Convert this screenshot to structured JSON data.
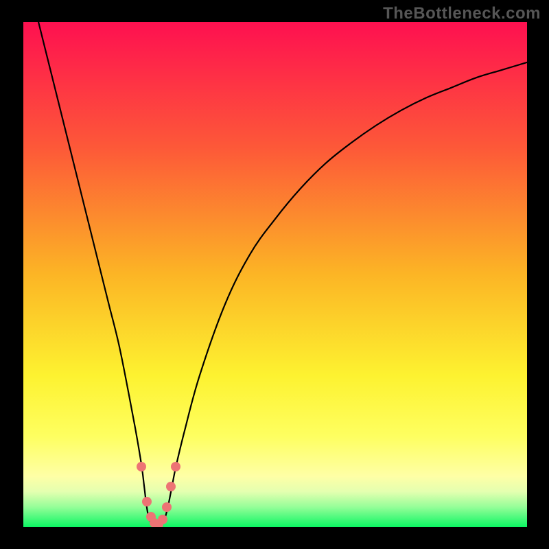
{
  "watermark": "TheBottleneck.com",
  "chart_data": {
    "type": "line",
    "title": "",
    "xlabel": "",
    "ylabel": "",
    "xlim": [
      0,
      100
    ],
    "ylim": [
      0,
      100
    ],
    "series": [
      {
        "name": "bottleneck-curve",
        "x": [
          3,
          5,
          7,
          9,
          11,
          13,
          15,
          17,
          19,
          21,
          22.5,
          23.5,
          24.0,
          24.5,
          25.0,
          25.8,
          26.5,
          27.2,
          28.0,
          28.7,
          29.5,
          30.3,
          32,
          35,
          40,
          45,
          50,
          55,
          60,
          65,
          70,
          75,
          80,
          85,
          90,
          95,
          100
        ],
        "y": [
          100,
          92,
          84,
          76,
          68,
          60,
          52,
          44,
          36,
          26,
          18,
          12,
          8,
          4,
          1.5,
          0.5,
          0.3,
          0.5,
          1.5,
          4,
          8,
          12,
          19,
          30,
          44,
          54,
          61,
          67,
          72,
          76,
          79.5,
          82.5,
          85,
          87,
          89,
          90.5,
          92
        ]
      }
    ],
    "highlight_points": {
      "name": "optimal-zone-markers",
      "x": [
        23.5,
        24.5,
        25.3,
        26.0,
        26.8,
        27.7,
        28.5,
        29.3,
        30.2
      ],
      "y": [
        12,
        5,
        2,
        0.8,
        0.6,
        1.5,
        4,
        8,
        12
      ]
    },
    "background_gradient": {
      "orientation": "vertical",
      "stops": [
        {
          "pos": 0.0,
          "color": "#fe1050"
        },
        {
          "pos": 0.25,
          "color": "#fd5938"
        },
        {
          "pos": 0.5,
          "color": "#fcb525"
        },
        {
          "pos": 0.7,
          "color": "#fdf230"
        },
        {
          "pos": 0.82,
          "color": "#feff60"
        },
        {
          "pos": 0.9,
          "color": "#feffa6"
        },
        {
          "pos": 0.93,
          "color": "#e4ffb0"
        },
        {
          "pos": 0.96,
          "color": "#96fe99"
        },
        {
          "pos": 1.0,
          "color": "#0cf663"
        }
      ]
    }
  }
}
